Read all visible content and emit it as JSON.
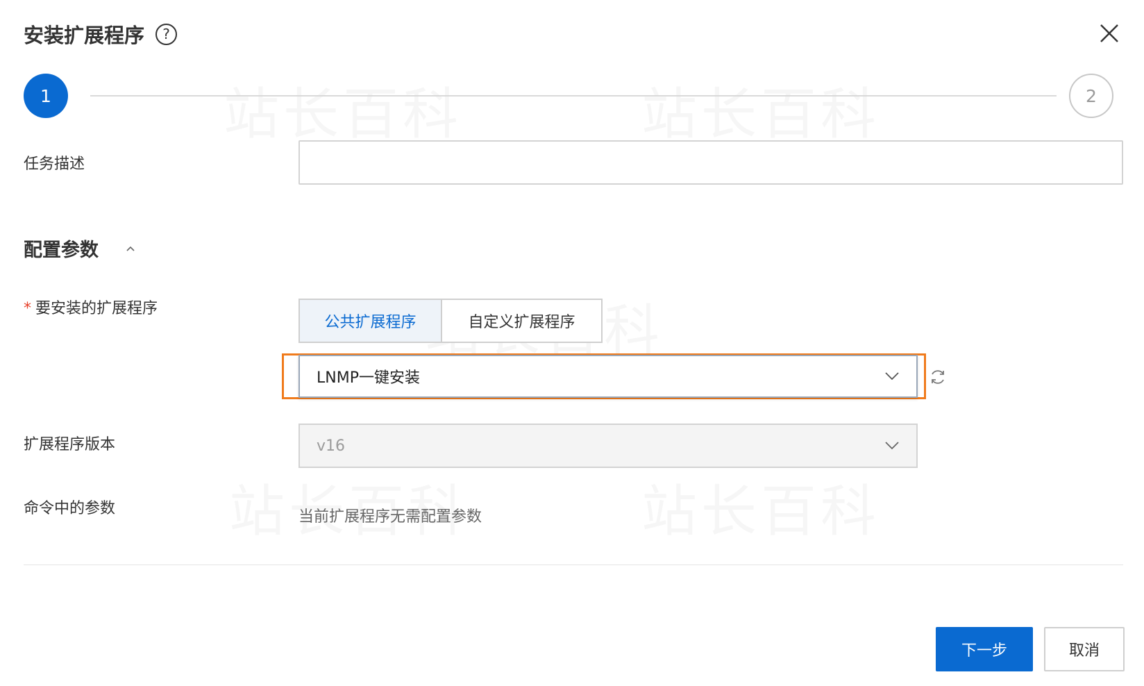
{
  "dialog": {
    "title": "安装扩展程序",
    "help_icon": "help-circle-icon",
    "close_icon": "close-icon"
  },
  "steps": [
    {
      "number": "1",
      "state": "active"
    },
    {
      "number": "2",
      "state": "pending"
    }
  ],
  "form": {
    "task_description": {
      "label": "任务描述",
      "value": "",
      "placeholder": ""
    },
    "config_section": {
      "title": "配置参数",
      "toggle_icon": "chevron-up-icon"
    },
    "extension": {
      "required_mark": "*",
      "label": "要安装的扩展程序",
      "tabs": [
        {
          "label": "公共扩展程序",
          "selected": true
        },
        {
          "label": "自定义扩展程序",
          "selected": false
        }
      ],
      "selected_value": "LNMP一键安装",
      "dropdown_icon": "chevron-down-icon",
      "refresh_icon": "refresh-icon"
    },
    "version": {
      "label": "扩展程序版本",
      "selected_value": "v16",
      "dropdown_icon": "chevron-down-icon"
    },
    "command_params": {
      "label": "命令中的参数",
      "value": "当前扩展程序无需配置参数"
    }
  },
  "footer": {
    "next_label": "下一步",
    "cancel_label": "取消"
  },
  "watermark": "站长百科",
  "colors": {
    "primary": "#0a6ad1",
    "highlight_border": "#f07b1c",
    "required": "#e6402a"
  }
}
